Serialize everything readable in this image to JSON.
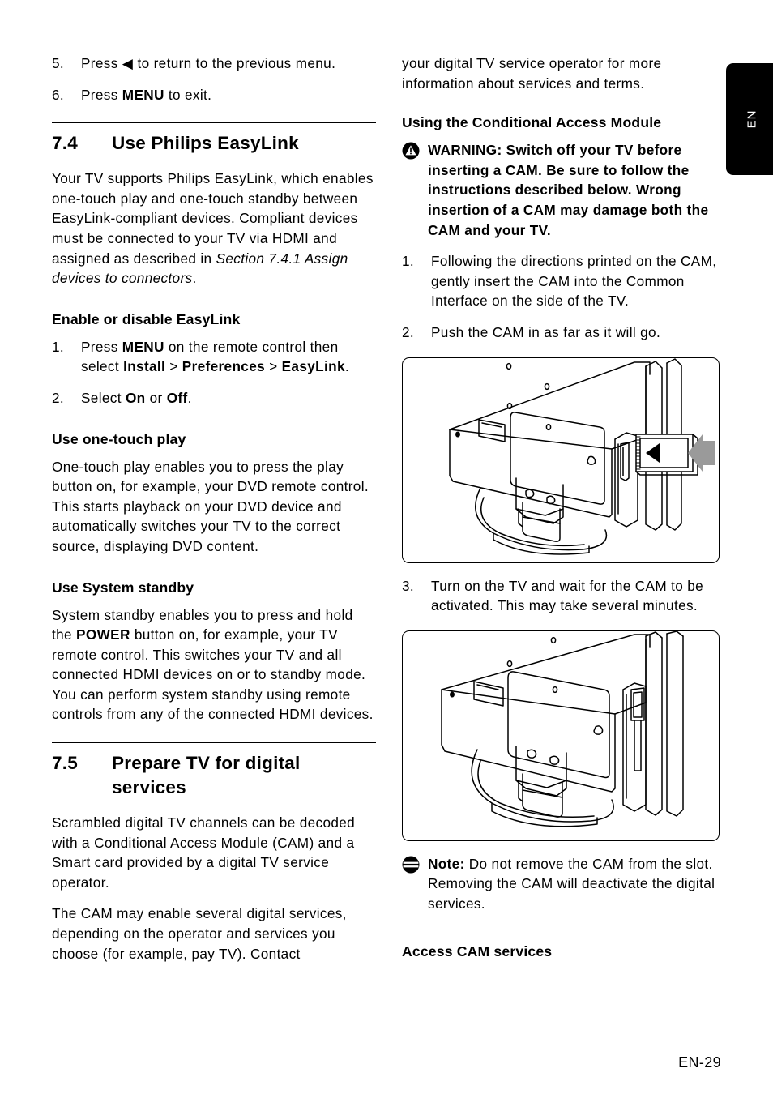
{
  "page": {
    "language_tab": "EN",
    "footer": "EN-29"
  },
  "left_column": {
    "steps_continued": [
      {
        "num": "5.",
        "text_before": "Press ",
        "glyph": "◀",
        "text_after": " to return to the previous menu."
      },
      {
        "num": "6.",
        "text_before": "Press ",
        "bold": "MENU",
        "text_after": " to exit."
      }
    ],
    "section_74": {
      "number": "7.4",
      "title": "Use Philips EasyLink",
      "intro_part1": "Your TV supports Philips EasyLink, which enables one-touch play and one-touch standby between EasyLink-compliant devices. Compliant devices must be connected to your TV via HDMI and assigned as described in ",
      "intro_italic": "Section 7.4.1 Assign devices to connectors",
      "intro_part2": "."
    },
    "enable_disable": {
      "heading": "Enable or disable EasyLink",
      "step1_num": "1.",
      "step1_a": "Press ",
      "step1_b1": "MENU",
      "step1_c": " on the remote control then select ",
      "step1_b2": "Install",
      "step1_d": " > ",
      "step1_b3": "Preferences",
      "step1_e": " > ",
      "step1_b4": "EasyLink",
      "step1_f": ".",
      "step2_num": "2.",
      "step2_a": "Select ",
      "step2_b1": "On",
      "step2_b": " or ",
      "step2_b2": "Off",
      "step2_c": "."
    },
    "one_touch_play": {
      "heading": "Use one-touch play",
      "body": "One-touch play enables you to press the play button on, for example, your DVD remote control. This starts playback on your DVD device and automatically switches your TV to the correct source, displaying DVD content."
    },
    "system_standby": {
      "heading": "Use System standby",
      "body_a": "System standby enables you to press and hold the ",
      "body_bold": "POWER",
      "body_b": " button on, for example, your TV remote control. This switches your TV and all connected HDMI devices on or to standby mode. You can perform system standby using remote controls from any of the connected HDMI devices."
    },
    "section_75": {
      "number": "7.5",
      "title_line1": "Prepare TV for digital",
      "title_line2": "services",
      "para1": "Scrambled digital TV channels can be decoded with a Conditional Access Module (CAM) and a Smart card provided by a digital TV service operator.",
      "para2": "The CAM may enable several digital services, depending on the operator and services you choose (for example, pay TV). Contact"
    }
  },
  "right_column": {
    "continuation": "your digital TV service operator for more information about services and terms.",
    "using_cam": {
      "heading": "Using the Conditional Access Module",
      "warning_icon": "warning-triangle-icon",
      "warning_label": "WARNING:",
      "warning_text": " Switch off your TV before inserting a CAM. Be sure to follow the instructions described below. Wrong insertion of a CAM may damage both the CAM and your TV.",
      "steps": [
        {
          "num": "1.",
          "text": "Following the directions printed on the CAM, gently insert the CAM into the Common Interface on the side of the TV."
        },
        {
          "num": "2.",
          "text": "Push the CAM in as far as it will go."
        },
        {
          "num": "3.",
          "text": "Turn on the TV and wait for the CAM to be activated. This may take several minutes."
        }
      ]
    },
    "figures": [
      {
        "name": "tv-rear-cam-insert-illustration",
        "caption": ""
      },
      {
        "name": "tv-rear-cam-inserted-illustration",
        "caption": ""
      }
    ],
    "note": {
      "icon": "note-info-icon",
      "label": "Note:",
      "text": " Do not remove the CAM from the slot. Removing the CAM will deactivate the digital services."
    },
    "access_cam_heading": "Access CAM services"
  }
}
